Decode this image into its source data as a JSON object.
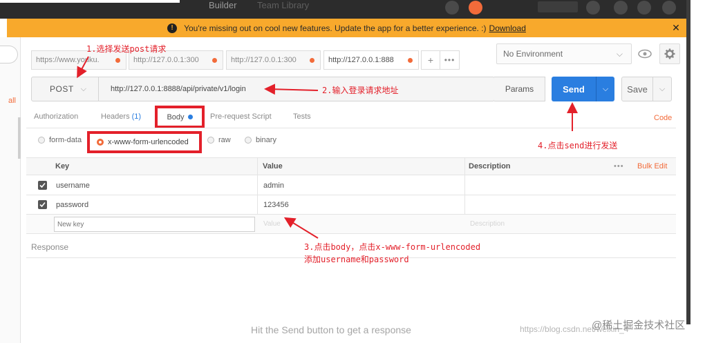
{
  "top_bar": {
    "tab_builder": "Builder",
    "tab_team_library": "Team Library"
  },
  "banner": {
    "message": "You're missing out on cool new features. Update the app for a better experience. :)",
    "link": "Download",
    "close": "✕",
    "color": "#f8a92c"
  },
  "sidebar": {
    "all_label": "all"
  },
  "request_tabs": [
    {
      "label": "https://www.youku.",
      "active": false
    },
    {
      "label": "http://127.0.0.1:300",
      "active": false
    },
    {
      "label": "http://127.0.0.1:300",
      "active": false
    },
    {
      "label": "http://127.0.0.1:888",
      "active": true
    }
  ],
  "tab_add": "+",
  "tab_more": "•••",
  "environment": {
    "selected": "No Environment"
  },
  "request": {
    "method": "POST",
    "url": "http://127.0.0.1:8888/api/private/v1/login",
    "params_label": "Params",
    "send_label": "Send",
    "save_label": "Save"
  },
  "section_tabs": {
    "authorization": "Authorization",
    "headers": "Headers",
    "headers_count": "(1)",
    "body": "Body",
    "prerequest": "Pre-request Script",
    "tests": "Tests",
    "code": "Code"
  },
  "body_types": {
    "form_data": "form-data",
    "urlencoded": "x-www-form-urlencoded",
    "raw": "raw",
    "binary": "binary",
    "selected": "x-www-form-urlencoded"
  },
  "table": {
    "headers": {
      "key": "Key",
      "value": "Value",
      "description": "Description"
    },
    "more": "•••",
    "bulk_edit": "Bulk Edit",
    "rows": [
      {
        "key": "username",
        "value": "admin",
        "checked": true
      },
      {
        "key": "password",
        "value": "123456",
        "checked": true
      }
    ],
    "new_row": {
      "key_placeholder": "New key",
      "value_placeholder": "Value",
      "description_placeholder": "Description"
    }
  },
  "response": {
    "label": "Response",
    "hint": "Hit the Send button to get a response"
  },
  "watermark": {
    "url": "https://blog.csdn.net/weixin_4",
    "site": "@稀土掘金技术社区"
  },
  "annotations": {
    "step1": "1.选择发送post请求",
    "step2": "2.输入登录请求地址",
    "step3_line1": "3.点击body，点击x-www-form-urlencoded",
    "step3_line2": "添加username和password",
    "step4": "4.点击send进行发送"
  },
  "colors": {
    "accent_orange": "#f26b3a",
    "send_blue": "#2a7ee0",
    "annotation_red": "#e3202a"
  }
}
